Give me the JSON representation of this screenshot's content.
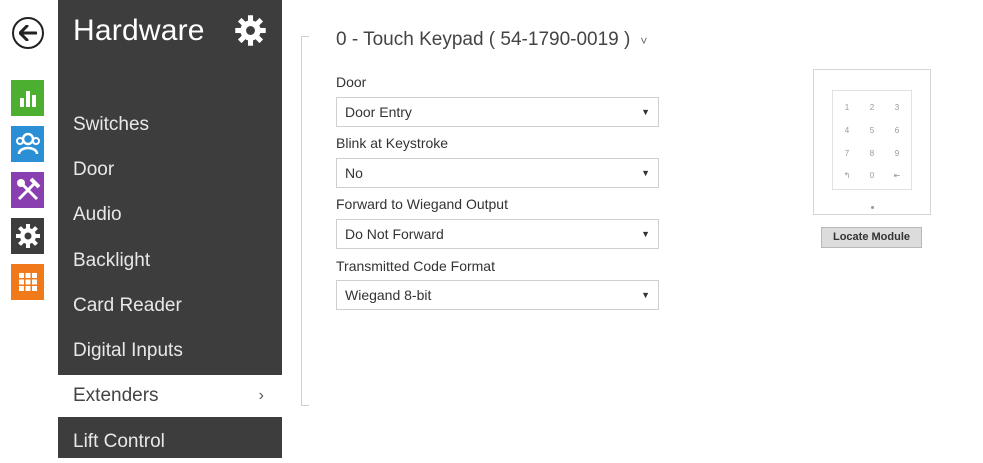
{
  "rail": {
    "icons": [
      {
        "name": "back-arrow-icon",
        "color": "#222222"
      },
      {
        "name": "status-chart-icon",
        "color": "#4caf2f"
      },
      {
        "name": "users-icon",
        "color": "#2a8fd4"
      },
      {
        "name": "tools-icon",
        "color": "#8a3fb0"
      },
      {
        "name": "settings-gear-icon",
        "color": "#3d3d3d"
      },
      {
        "name": "apps-grid-icon",
        "color": "#f07a19"
      }
    ]
  },
  "sidebar": {
    "title": "Hardware",
    "gear_icon": "gear-icon",
    "items": [
      {
        "label": "Switches"
      },
      {
        "label": "Door"
      },
      {
        "label": "Audio"
      },
      {
        "label": "Backlight"
      },
      {
        "label": "Card Reader"
      },
      {
        "label": "Digital Inputs"
      },
      {
        "label": "Extenders",
        "active": true,
        "chevron": "›"
      },
      {
        "label": "Lift Control"
      }
    ]
  },
  "main": {
    "module_title": "0 - Touch Keypad ( 54-1790-0019 )",
    "module_caret": "˅",
    "fields": [
      {
        "label": "Door",
        "value": "Door Entry"
      },
      {
        "label": "Blink at Keystroke",
        "value": "No"
      },
      {
        "label": "Forward to Wiegand Output",
        "value": "Do Not Forward"
      },
      {
        "label": "Transmitted Code Format",
        "value": "Wiegand 8-bit"
      }
    ],
    "select_arrow": "▼"
  },
  "keypad": {
    "keys": [
      "1",
      "2",
      "3",
      "4",
      "5",
      "6",
      "7",
      "8",
      "9",
      "↰",
      "0",
      "⇤"
    ]
  },
  "locate_button": "Locate Module"
}
